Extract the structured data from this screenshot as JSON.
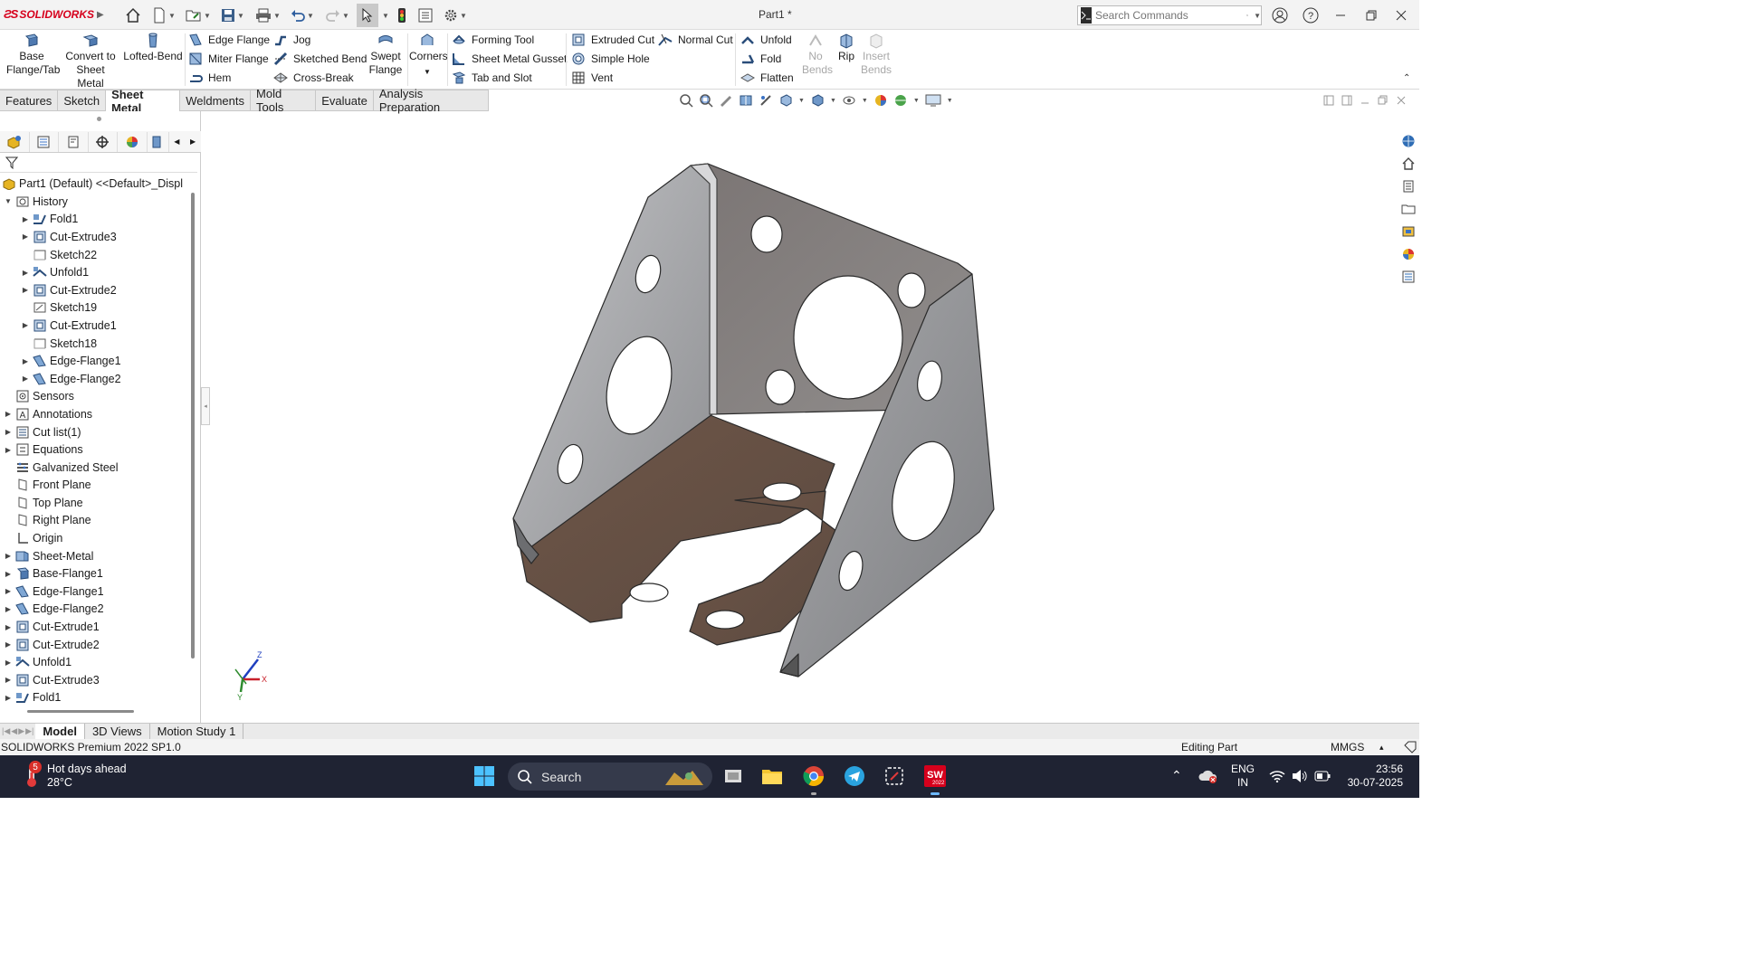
{
  "app": {
    "brand": "SOLIDWORKS",
    "doc_title": "Part1 *"
  },
  "search": {
    "placeholder": "Search Commands"
  },
  "ribbon": {
    "base_flange": "Base Flange/Tab",
    "convert": "Convert to Sheet Metal",
    "lofted_bend": "Lofted-Bend",
    "edge_flange": "Edge Flange",
    "miter_flange": "Miter Flange",
    "hem": "Hem",
    "jog": "Jog",
    "sketched_bend": "Sketched Bend",
    "cross_break": "Cross-Break",
    "swept_flange": "Swept Flange",
    "corners": "Corners",
    "forming_tool": "Forming Tool",
    "sheet_metal_gusset": "Sheet Metal Gusset",
    "tab_and_slot": "Tab and Slot",
    "extruded_cut": "Extruded Cut",
    "simple_hole": "Simple Hole",
    "vent": "Vent",
    "normal_cut": "Normal Cut",
    "unfold": "Unfold",
    "fold": "Fold",
    "flatten": "Flatten",
    "no_bends": "No Bends",
    "rip": "Rip",
    "insert_bends": "Insert Bends"
  },
  "tabs": [
    "Features",
    "Sketch",
    "Sheet Metal",
    "Weldments",
    "Mold Tools",
    "Evaluate",
    "Analysis Preparation"
  ],
  "active_tab": "Sheet Metal",
  "tree": {
    "root": "Part1 (Default) <<Default>_Displ",
    "items": [
      {
        "label": "History",
        "level": 1,
        "expander": "down",
        "icon": "history"
      },
      {
        "label": "Fold1",
        "level": 2,
        "expander": "right",
        "icon": "fold"
      },
      {
        "label": "Cut-Extrude3",
        "level": 2,
        "expander": "right",
        "icon": "cut"
      },
      {
        "label": "Sketch22",
        "level": 2,
        "expander": "",
        "icon": "sketch"
      },
      {
        "label": "Unfold1",
        "level": 2,
        "expander": "right",
        "icon": "unfold"
      },
      {
        "label": "Cut-Extrude2",
        "level": 2,
        "expander": "right",
        "icon": "cut"
      },
      {
        "label": "Sketch19",
        "level": 2,
        "expander": "",
        "icon": "sketch3d"
      },
      {
        "label": "Cut-Extrude1",
        "level": 2,
        "expander": "right",
        "icon": "cut"
      },
      {
        "label": "Sketch18",
        "level": 2,
        "expander": "",
        "icon": "sketch"
      },
      {
        "label": "Edge-Flange1",
        "level": 2,
        "expander": "right",
        "icon": "edgeflange"
      },
      {
        "label": "Edge-Flange2",
        "level": 2,
        "expander": "right",
        "icon": "edgeflange"
      },
      {
        "label": "Sensors",
        "level": 1,
        "expander": "",
        "icon": "sensor"
      },
      {
        "label": "Annotations",
        "level": 1,
        "expander": "right",
        "icon": "annotation"
      },
      {
        "label": "Cut list(1)",
        "level": 1,
        "expander": "right",
        "icon": "cutlist"
      },
      {
        "label": "Equations",
        "level": 1,
        "expander": "right",
        "icon": "equation"
      },
      {
        "label": "Galvanized Steel",
        "level": 1,
        "expander": "",
        "icon": "material"
      },
      {
        "label": "Front Plane",
        "level": 1,
        "expander": "",
        "icon": "plane"
      },
      {
        "label": "Top Plane",
        "level": 1,
        "expander": "",
        "icon": "plane"
      },
      {
        "label": "Right Plane",
        "level": 1,
        "expander": "",
        "icon": "plane"
      },
      {
        "label": "Origin",
        "level": 1,
        "expander": "",
        "icon": "origin"
      },
      {
        "label": "Sheet-Metal",
        "level": 1,
        "expander": "right",
        "icon": "sheetmetal"
      },
      {
        "label": "Base-Flange1",
        "level": 1,
        "expander": "right",
        "icon": "baseflange"
      },
      {
        "label": "Edge-Flange1",
        "level": 1,
        "expander": "right",
        "icon": "edgeflange"
      },
      {
        "label": "Edge-Flange2",
        "level": 1,
        "expander": "right",
        "icon": "edgeflange"
      },
      {
        "label": "Cut-Extrude1",
        "level": 1,
        "expander": "right",
        "icon": "cut"
      },
      {
        "label": "Cut-Extrude2",
        "level": 1,
        "expander": "right",
        "icon": "cut"
      },
      {
        "label": "Unfold1",
        "level": 1,
        "expander": "right",
        "icon": "unfold"
      },
      {
        "label": "Cut-Extrude3",
        "level": 1,
        "expander": "right",
        "icon": "cut"
      },
      {
        "label": "Fold1",
        "level": 1,
        "expander": "right",
        "icon": "fold"
      }
    ]
  },
  "bottom_tabs": [
    "Model",
    "3D Views",
    "Motion Study 1"
  ],
  "triad": {
    "z": "Z",
    "x": "X",
    "y": "Y"
  },
  "status": {
    "version": "SOLIDWORKS Premium 2022 SP1.0",
    "mode": "Editing Part",
    "units": "MMGS"
  },
  "taskbar": {
    "weather_title": "Hot days ahead",
    "weather_temp": "28°C",
    "weather_badge": "5",
    "search": "Search",
    "lang1": "ENG",
    "lang2": "IN",
    "time": "23:56",
    "date": "30-07-2025",
    "sw_badge": "2022"
  },
  "colors": {
    "accent": "#d6001c",
    "metal_light": "#a9aaad",
    "metal_dark": "#5a4a40",
    "taskbar": "#1f2333"
  }
}
